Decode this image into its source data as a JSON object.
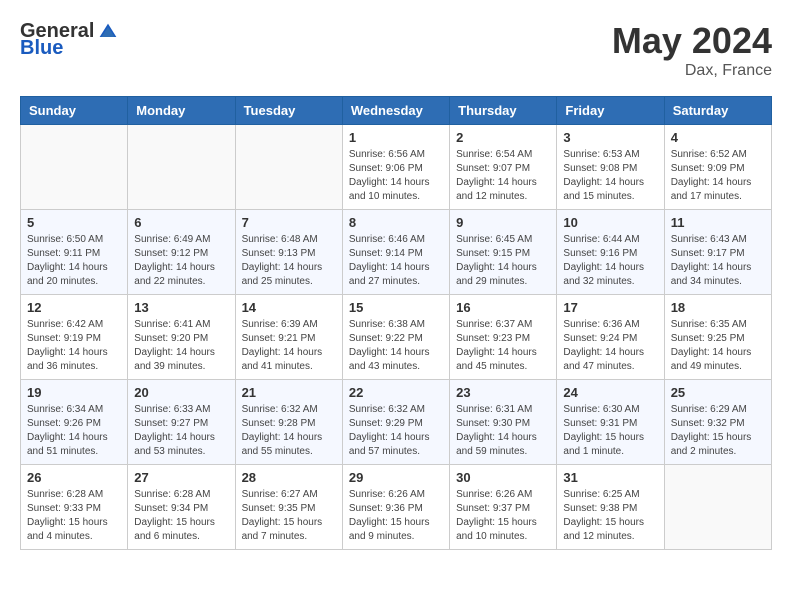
{
  "header": {
    "logo_general": "General",
    "logo_blue": "Blue",
    "month_year": "May 2024",
    "location": "Dax, France"
  },
  "weekdays": [
    "Sunday",
    "Monday",
    "Tuesday",
    "Wednesday",
    "Thursday",
    "Friday",
    "Saturday"
  ],
  "weeks": [
    [
      {
        "day": "",
        "info": ""
      },
      {
        "day": "",
        "info": ""
      },
      {
        "day": "",
        "info": ""
      },
      {
        "day": "1",
        "info": "Sunrise: 6:56 AM\nSunset: 9:06 PM\nDaylight: 14 hours\nand 10 minutes."
      },
      {
        "day": "2",
        "info": "Sunrise: 6:54 AM\nSunset: 9:07 PM\nDaylight: 14 hours\nand 12 minutes."
      },
      {
        "day": "3",
        "info": "Sunrise: 6:53 AM\nSunset: 9:08 PM\nDaylight: 14 hours\nand 15 minutes."
      },
      {
        "day": "4",
        "info": "Sunrise: 6:52 AM\nSunset: 9:09 PM\nDaylight: 14 hours\nand 17 minutes."
      }
    ],
    [
      {
        "day": "5",
        "info": "Sunrise: 6:50 AM\nSunset: 9:11 PM\nDaylight: 14 hours\nand 20 minutes."
      },
      {
        "day": "6",
        "info": "Sunrise: 6:49 AM\nSunset: 9:12 PM\nDaylight: 14 hours\nand 22 minutes."
      },
      {
        "day": "7",
        "info": "Sunrise: 6:48 AM\nSunset: 9:13 PM\nDaylight: 14 hours\nand 25 minutes."
      },
      {
        "day": "8",
        "info": "Sunrise: 6:46 AM\nSunset: 9:14 PM\nDaylight: 14 hours\nand 27 minutes."
      },
      {
        "day": "9",
        "info": "Sunrise: 6:45 AM\nSunset: 9:15 PM\nDaylight: 14 hours\nand 29 minutes."
      },
      {
        "day": "10",
        "info": "Sunrise: 6:44 AM\nSunset: 9:16 PM\nDaylight: 14 hours\nand 32 minutes."
      },
      {
        "day": "11",
        "info": "Sunrise: 6:43 AM\nSunset: 9:17 PM\nDaylight: 14 hours\nand 34 minutes."
      }
    ],
    [
      {
        "day": "12",
        "info": "Sunrise: 6:42 AM\nSunset: 9:19 PM\nDaylight: 14 hours\nand 36 minutes."
      },
      {
        "day": "13",
        "info": "Sunrise: 6:41 AM\nSunset: 9:20 PM\nDaylight: 14 hours\nand 39 minutes."
      },
      {
        "day": "14",
        "info": "Sunrise: 6:39 AM\nSunset: 9:21 PM\nDaylight: 14 hours\nand 41 minutes."
      },
      {
        "day": "15",
        "info": "Sunrise: 6:38 AM\nSunset: 9:22 PM\nDaylight: 14 hours\nand 43 minutes."
      },
      {
        "day": "16",
        "info": "Sunrise: 6:37 AM\nSunset: 9:23 PM\nDaylight: 14 hours\nand 45 minutes."
      },
      {
        "day": "17",
        "info": "Sunrise: 6:36 AM\nSunset: 9:24 PM\nDaylight: 14 hours\nand 47 minutes."
      },
      {
        "day": "18",
        "info": "Sunrise: 6:35 AM\nSunset: 9:25 PM\nDaylight: 14 hours\nand 49 minutes."
      }
    ],
    [
      {
        "day": "19",
        "info": "Sunrise: 6:34 AM\nSunset: 9:26 PM\nDaylight: 14 hours\nand 51 minutes."
      },
      {
        "day": "20",
        "info": "Sunrise: 6:33 AM\nSunset: 9:27 PM\nDaylight: 14 hours\nand 53 minutes."
      },
      {
        "day": "21",
        "info": "Sunrise: 6:32 AM\nSunset: 9:28 PM\nDaylight: 14 hours\nand 55 minutes."
      },
      {
        "day": "22",
        "info": "Sunrise: 6:32 AM\nSunset: 9:29 PM\nDaylight: 14 hours\nand 57 minutes."
      },
      {
        "day": "23",
        "info": "Sunrise: 6:31 AM\nSunset: 9:30 PM\nDaylight: 14 hours\nand 59 minutes."
      },
      {
        "day": "24",
        "info": "Sunrise: 6:30 AM\nSunset: 9:31 PM\nDaylight: 15 hours\nand 1 minute."
      },
      {
        "day": "25",
        "info": "Sunrise: 6:29 AM\nSunset: 9:32 PM\nDaylight: 15 hours\nand 2 minutes."
      }
    ],
    [
      {
        "day": "26",
        "info": "Sunrise: 6:28 AM\nSunset: 9:33 PM\nDaylight: 15 hours\nand 4 minutes."
      },
      {
        "day": "27",
        "info": "Sunrise: 6:28 AM\nSunset: 9:34 PM\nDaylight: 15 hours\nand 6 minutes."
      },
      {
        "day": "28",
        "info": "Sunrise: 6:27 AM\nSunset: 9:35 PM\nDaylight: 15 hours\nand 7 minutes."
      },
      {
        "day": "29",
        "info": "Sunrise: 6:26 AM\nSunset: 9:36 PM\nDaylight: 15 hours\nand 9 minutes."
      },
      {
        "day": "30",
        "info": "Sunrise: 6:26 AM\nSunset: 9:37 PM\nDaylight: 15 hours\nand 10 minutes."
      },
      {
        "day": "31",
        "info": "Sunrise: 6:25 AM\nSunset: 9:38 PM\nDaylight: 15 hours\nand 12 minutes."
      },
      {
        "day": "",
        "info": ""
      }
    ]
  ]
}
